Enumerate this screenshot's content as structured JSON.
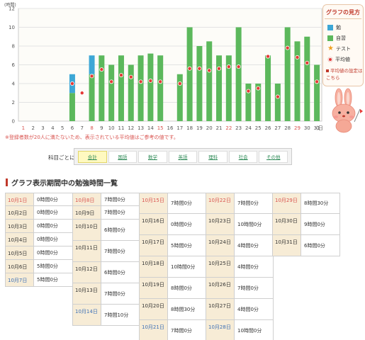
{
  "chart_data": {
    "type": "bar",
    "ylabel": "(時間)",
    "ylim": [
      0,
      12
    ],
    "yticks": [
      0,
      2,
      4,
      6,
      8,
      10,
      12
    ],
    "xsuffix": "(日)",
    "categories": [
      "1",
      "2",
      "3",
      "4",
      "5",
      "6",
      "7",
      "8",
      "9",
      "10",
      "11",
      "12",
      "13",
      "14",
      "15",
      "16",
      "17",
      "18",
      "19",
      "20",
      "21",
      "22",
      "23",
      "24",
      "25",
      "26",
      "27",
      "28",
      "29",
      "30",
      "31"
    ],
    "sundays": [
      "1",
      "8",
      "15",
      "22",
      "29"
    ],
    "series": [
      {
        "name": "勉",
        "color": "#3da7d6",
        "values": [
          0,
          0,
          0,
          0,
          0,
          2,
          0,
          2,
          0,
          0,
          0,
          0,
          0,
          0,
          0,
          0,
          0,
          0,
          0,
          0,
          0,
          0,
          0,
          0,
          0,
          0,
          0,
          0,
          0,
          0,
          0
        ]
      },
      {
        "name": "自習",
        "color": "#5cb85c",
        "values": [
          0,
          0,
          0,
          0,
          0,
          3,
          0,
          5,
          7,
          6,
          7,
          6,
          7,
          7.2,
          7,
          0,
          5,
          10,
          8,
          8.5,
          7,
          7,
          10,
          4,
          4,
          7,
          4,
          10,
          8.5,
          9,
          6
        ]
      },
      {
        "name": "平均値",
        "type": "point",
        "color": "#e53935",
        "values": [
          null,
          null,
          null,
          null,
          null,
          4,
          3,
          4.8,
          5.5,
          4.2,
          4.9,
          4.7,
          4.2,
          4.3,
          4.2,
          null,
          4,
          5.6,
          5.6,
          5.4,
          5.6,
          5.8,
          5.8,
          3.2,
          3.5,
          6.9,
          2.6,
          7.8,
          6.8,
          6.2,
          4.2
        ]
      }
    ]
  },
  "legend": {
    "title": "グラフの見方",
    "items": [
      {
        "label": "勉",
        "icon": "blue-square"
      },
      {
        "label": "自習",
        "icon": "green-square"
      },
      {
        "label": "テスト",
        "icon": "star-icon"
      },
      {
        "label": "平均値",
        "icon": "red-dot"
      }
    ],
    "avg_setting_link": "平均値の設定はこちら"
  },
  "notice": "※登録者数が20人に満たないため、表示されている平均値はご参考の値です。",
  "subject_filter": {
    "label": "科目ごとに表示",
    "tabs": [
      "合計",
      "国語",
      "数学",
      "英語",
      "理科",
      "社会",
      "その他"
    ],
    "active": "合計"
  },
  "table_title": "グラフ表示期間中の勉強時間一覧",
  "colors": {
    "accent": "#c0392b",
    "date_bg": "#f7ecd6",
    "sunday": "#d9534f",
    "saturday": "#3b6fb6"
  },
  "study_table": [
    [
      {
        "date": "10月1日",
        "time": "0時間0分",
        "day": "sun"
      },
      {
        "date": "10月2日",
        "time": "0時間0分",
        "day": ""
      },
      {
        "date": "10月3日",
        "time": "0時間0分",
        "day": ""
      },
      {
        "date": "10月4日",
        "time": "0時間0分",
        "day": ""
      },
      {
        "date": "10月5日",
        "time": "0時間0分",
        "day": ""
      },
      {
        "date": "10月6日",
        "time": "5時間0分",
        "day": ""
      },
      {
        "date": "10月7日",
        "time": "5時間0分",
        "day": "sat"
      }
    ],
    [
      {
        "date": "10月8日",
        "time": "7時間0分",
        "day": "sun"
      },
      {
        "date": "10月9日",
        "time": "7時間0分",
        "day": ""
      },
      {
        "date": "10月10日",
        "time": "6時間0分",
        "day": ""
      },
      {
        "date": "10月11日",
        "time": "7時間0分",
        "day": ""
      },
      {
        "date": "10月12日",
        "time": "6時間0分",
        "day": ""
      },
      {
        "date": "10月13日",
        "time": "7時間0分",
        "day": ""
      },
      {
        "date": "10月14日",
        "time": "7時間10分",
        "day": "sat"
      }
    ],
    [
      {
        "date": "10月15日",
        "time": "7時間0分",
        "day": "sun"
      },
      {
        "date": "10月16日",
        "time": "0時間0分",
        "day": ""
      },
      {
        "date": "10月17日",
        "time": "5時間0分",
        "day": ""
      },
      {
        "date": "10月18日",
        "time": "10時間0分",
        "day": ""
      },
      {
        "date": "10月19日",
        "time": "8時間0分",
        "day": ""
      },
      {
        "date": "10月20日",
        "time": "8時間30分",
        "day": ""
      },
      {
        "date": "10月21日",
        "time": "7時間0分",
        "day": "sat"
      }
    ],
    [
      {
        "date": "10月22日",
        "time": "7時間0分",
        "day": "sun"
      },
      {
        "date": "10月23日",
        "time": "10時間0分",
        "day": ""
      },
      {
        "date": "10月24日",
        "time": "4時間0分",
        "day": ""
      },
      {
        "date": "10月25日",
        "time": "4時間0分",
        "day": ""
      },
      {
        "date": "10月26日",
        "time": "7時間0分",
        "day": ""
      },
      {
        "date": "10月27日",
        "time": "4時間0分",
        "day": ""
      },
      {
        "date": "10月28日",
        "time": "10時間0分",
        "day": "sat"
      }
    ],
    [
      {
        "date": "10月29日",
        "time": "8時間30分",
        "day": "sun"
      },
      {
        "date": "10月30日",
        "time": "9時間0分",
        "day": ""
      },
      {
        "date": "10月31日",
        "time": "6時間0分",
        "day": ""
      }
    ]
  ]
}
